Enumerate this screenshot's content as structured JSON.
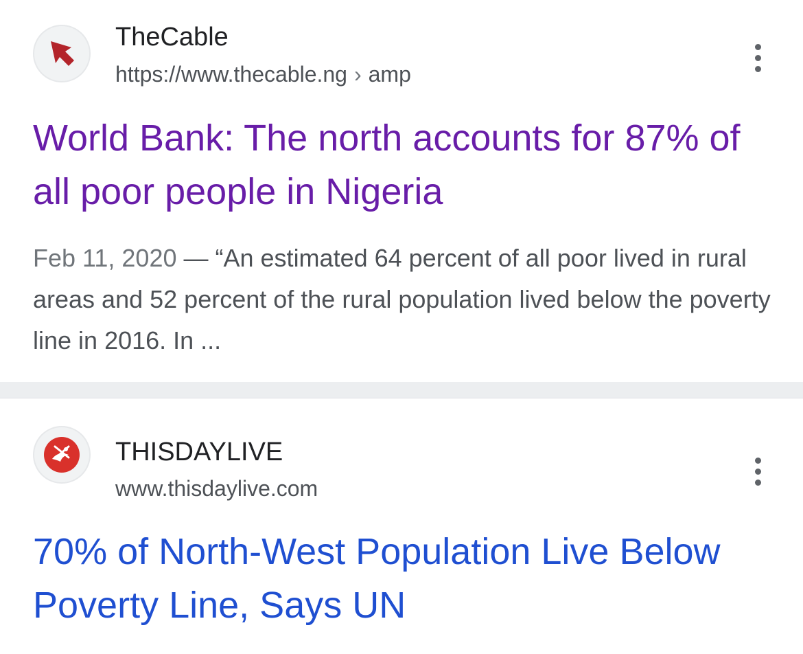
{
  "results": [
    {
      "site_name": "TheCable",
      "url_base": "https://www.thecable.ng",
      "url_separator": "›",
      "url_path": "amp",
      "title": "World Bank: The north accounts for 87% of all poor people in Nigeria",
      "date": "Feb 11, 2020",
      "date_separator": " — ",
      "snippet": "“An estimated 64 percent of all poor lived in rural areas and 52 percent of the rural population lived below the poverty line in 2016. In ...",
      "favicon": "red-arrow-icon",
      "title_color": "#681da8"
    },
    {
      "site_name": "THISDAYLIVE",
      "url_base": "www.thisdaylive.com",
      "title": "70% of North-West Population Live Below Poverty Line, Says UN",
      "favicon": "thisday-bird-icon",
      "title_color": "#1f4fd1"
    }
  ]
}
